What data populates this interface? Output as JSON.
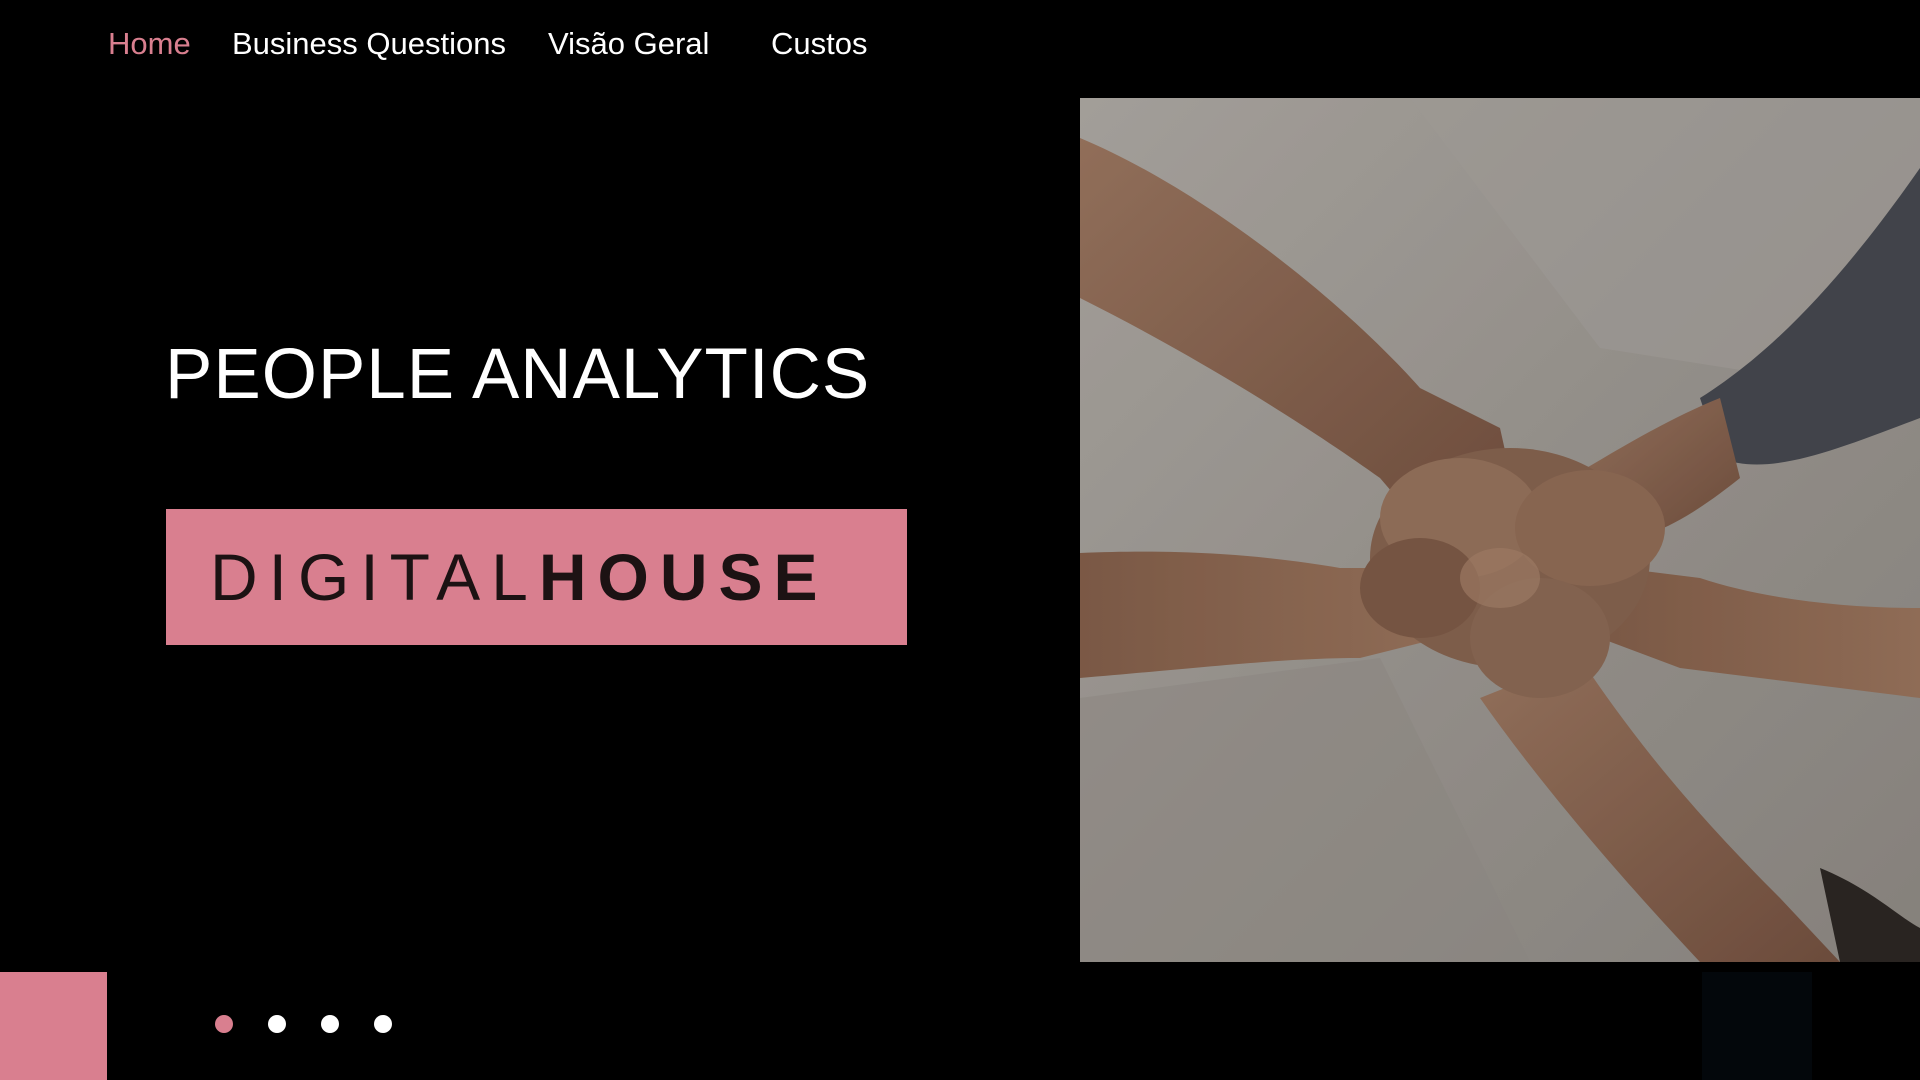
{
  "nav": {
    "items": [
      {
        "label": "Home",
        "active": true
      },
      {
        "label": "Business Questions",
        "active": false
      },
      {
        "label": "Visão Geral",
        "active": false
      },
      {
        "label": "Custos",
        "active": false
      }
    ]
  },
  "hero": {
    "title": "PEOPLE ANALYTICS",
    "logo": {
      "light_part": "DIGITAL",
      "bold_part": "HOUSE"
    }
  },
  "carousel": {
    "slide_count": 4,
    "active_index": 0
  },
  "colors": {
    "accent": "#d97f8f",
    "background": "#000000",
    "text": "#ffffff"
  },
  "image": {
    "subject": "hands-fist-bump-photo"
  }
}
